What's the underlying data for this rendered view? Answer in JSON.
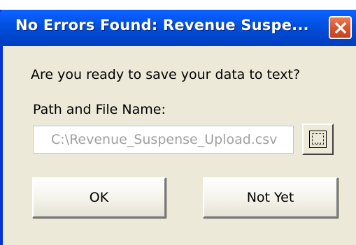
{
  "dialog": {
    "title": "No Errors Found: Revenue Suspe...",
    "question": "Are you ready to save your data to text?",
    "path_label": "Path and File Name:",
    "path_value": "C:\\Revenue_Suspense_Upload.csv",
    "browse_label": "...",
    "ok_label": "OK",
    "not_yet_label": "Not Yet",
    "close_icon": "close-icon"
  },
  "colors": {
    "titlebar": "#0152E1",
    "close_button": "#D8552E",
    "dialog_background": "#ECE9D8",
    "disabled_text": "#A0A0A0"
  }
}
